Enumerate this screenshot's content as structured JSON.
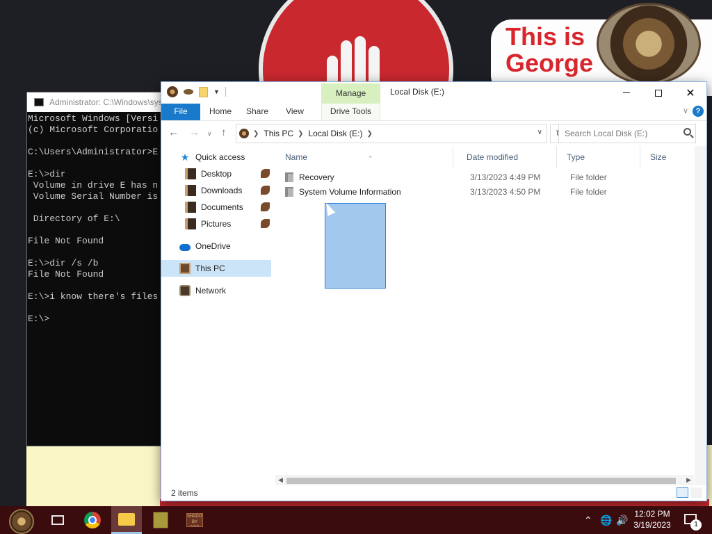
{
  "wallpaper": {
    "banner_text_1": "This is",
    "banner_text_2": "George"
  },
  "console": {
    "title": "Administrator: C:\\Windows\\sys",
    "lines": [
      "Microsoft Windows [Versi",
      "(c) Microsoft Corporatio",
      "",
      "C:\\Users\\Administrator>E",
      "",
      "E:\\>dir",
      " Volume in drive E has n",
      " Volume Serial Number is",
      "",
      " Directory of E:\\",
      "",
      "File Not Found",
      "",
      "E:\\>dir /s /b",
      "File Not Found",
      "",
      "E:\\>i know there's files",
      "",
      "E:\\>"
    ]
  },
  "explorer": {
    "title": "Local Disk (E:)",
    "contextual_group": "Manage",
    "ribbon_tabs": {
      "file": "File",
      "home": "Home",
      "share": "Share",
      "view": "View",
      "drive_tools": "Drive Tools"
    },
    "help_label": "?",
    "address": {
      "crumbs": [
        "This PC",
        "Local Disk (E:)"
      ]
    },
    "search": {
      "placeholder": "Search Local Disk (E:)"
    },
    "nav_pane": [
      {
        "label": "Quick access",
        "icon": "star-icon"
      },
      {
        "label": "Desktop",
        "icon": "desktop-folder-icon",
        "pinned": true
      },
      {
        "label": "Downloads",
        "icon": "downloads-folder-icon",
        "pinned": true
      },
      {
        "label": "Documents",
        "icon": "documents-folder-icon",
        "pinned": true
      },
      {
        "label": "Pictures",
        "icon": "pictures-folder-icon",
        "pinned": true
      },
      {
        "label": "OneDrive",
        "icon": "cloud-icon"
      },
      {
        "label": "This PC",
        "icon": "computer-icon",
        "selected": true
      },
      {
        "label": "Network",
        "icon": "network-icon"
      }
    ],
    "columns": {
      "name": "Name",
      "date": "Date modified",
      "type": "Type",
      "size": "Size"
    },
    "files": [
      {
        "name": "Recovery",
        "date": "3/13/2023 4:49 PM",
        "type": "File folder"
      },
      {
        "name": "System Volume Information",
        "date": "3/13/2023 4:50 PM",
        "type": "File folder"
      }
    ],
    "status": "2 items"
  },
  "taskbar": {
    "time": "12:02 PM",
    "date": "3/19/2023",
    "notification_count": "1",
    "app2_label": "SHADOW BY BOB"
  }
}
